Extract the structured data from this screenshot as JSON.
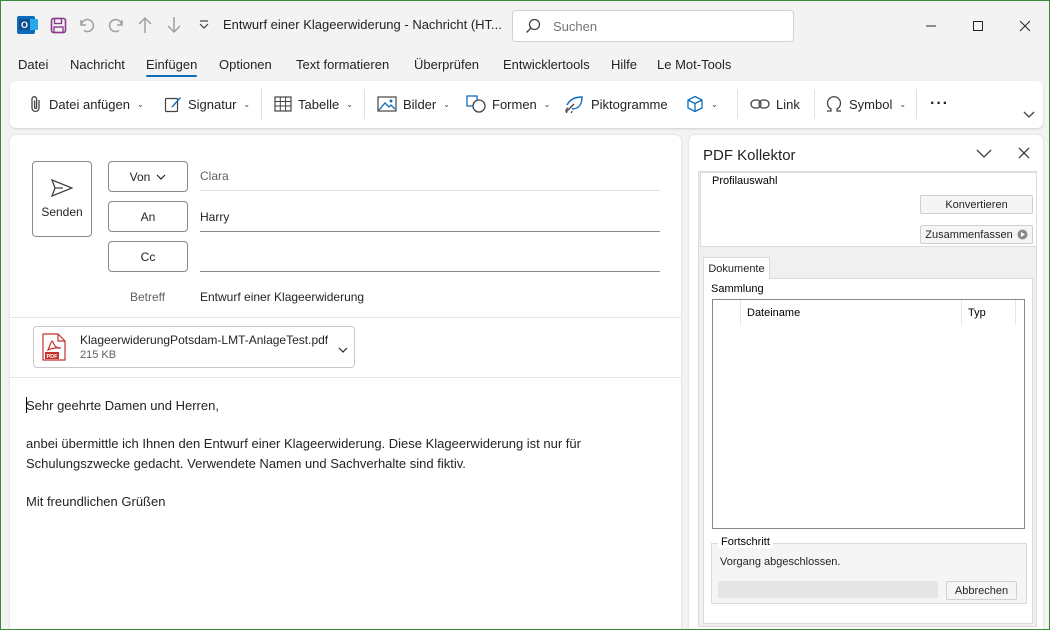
{
  "window": {
    "title": "Entwurf einer Klageerwiderung  -  Nachricht (HT...",
    "search_placeholder": "Suchen"
  },
  "icons": {
    "app": "outlook-icon",
    "save": "save-icon",
    "undo": "undo-icon",
    "redo": "redo-icon",
    "up": "arrow-up-icon",
    "down": "arrow-down-icon",
    "qat_more": "qat-more-icon",
    "minimize": "minimize-icon",
    "maximize": "maximize-icon",
    "close": "close-icon"
  },
  "menu": {
    "tabs": [
      "Datei",
      "Nachricht",
      "Einfügen",
      "Optionen",
      "Text formatieren",
      "Überprüfen",
      "Entwicklertools",
      "Hilfe",
      "Le Mot-Tools"
    ],
    "active_tab": "Einfügen"
  },
  "ribbon": {
    "attach_file": "Datei anfügen",
    "signature": "Signatur",
    "table": "Tabelle",
    "pictures": "Bilder",
    "shapes": "Formen",
    "icons": "Piktogramme",
    "link": "Link",
    "symbol": "Symbol",
    "more": "···"
  },
  "compose": {
    "send_label": "Senden",
    "from_label": "Von",
    "from_value": "Clara",
    "to_label": "An",
    "to_value": "Harry",
    "cc_label": "Cc",
    "cc_value": "",
    "subject_label": "Betreff",
    "subject_value": "Entwurf einer Klageerwiderung",
    "attachment": {
      "name": "KlageerwiderungPotsdam-LMT-AnlageTest.pdf",
      "size": "215 KB",
      "icon_text": "PDF"
    },
    "body": {
      "greeting": "Sehr geehrte Damen und Herren,",
      "line1": "anbei übermittle ich Ihnen den Entwurf einer Klageerwiderung. Diese Klageerwiderung ist nur für",
      "line2": "Schulungszwecke gedacht. Verwendete Namen und Sachverhalte sind fiktiv.",
      "closing": "Mit freundlichen Grüßen"
    }
  },
  "sidepane": {
    "title": "PDF Kollektor",
    "profile_group": "Profilauswahl",
    "convert_button": "Konvertieren",
    "summarize_button": "Zusammenfassen",
    "tab_documents": "Dokumente",
    "collection_label": "Sammlung",
    "columns": [
      "Dateiname",
      "Typ"
    ],
    "rows": [],
    "progress_group": "Fortschritt",
    "progress_status": "Vorgang abgeschlossen.",
    "progress_value": 0,
    "cancel_button": "Abbrechen"
  }
}
